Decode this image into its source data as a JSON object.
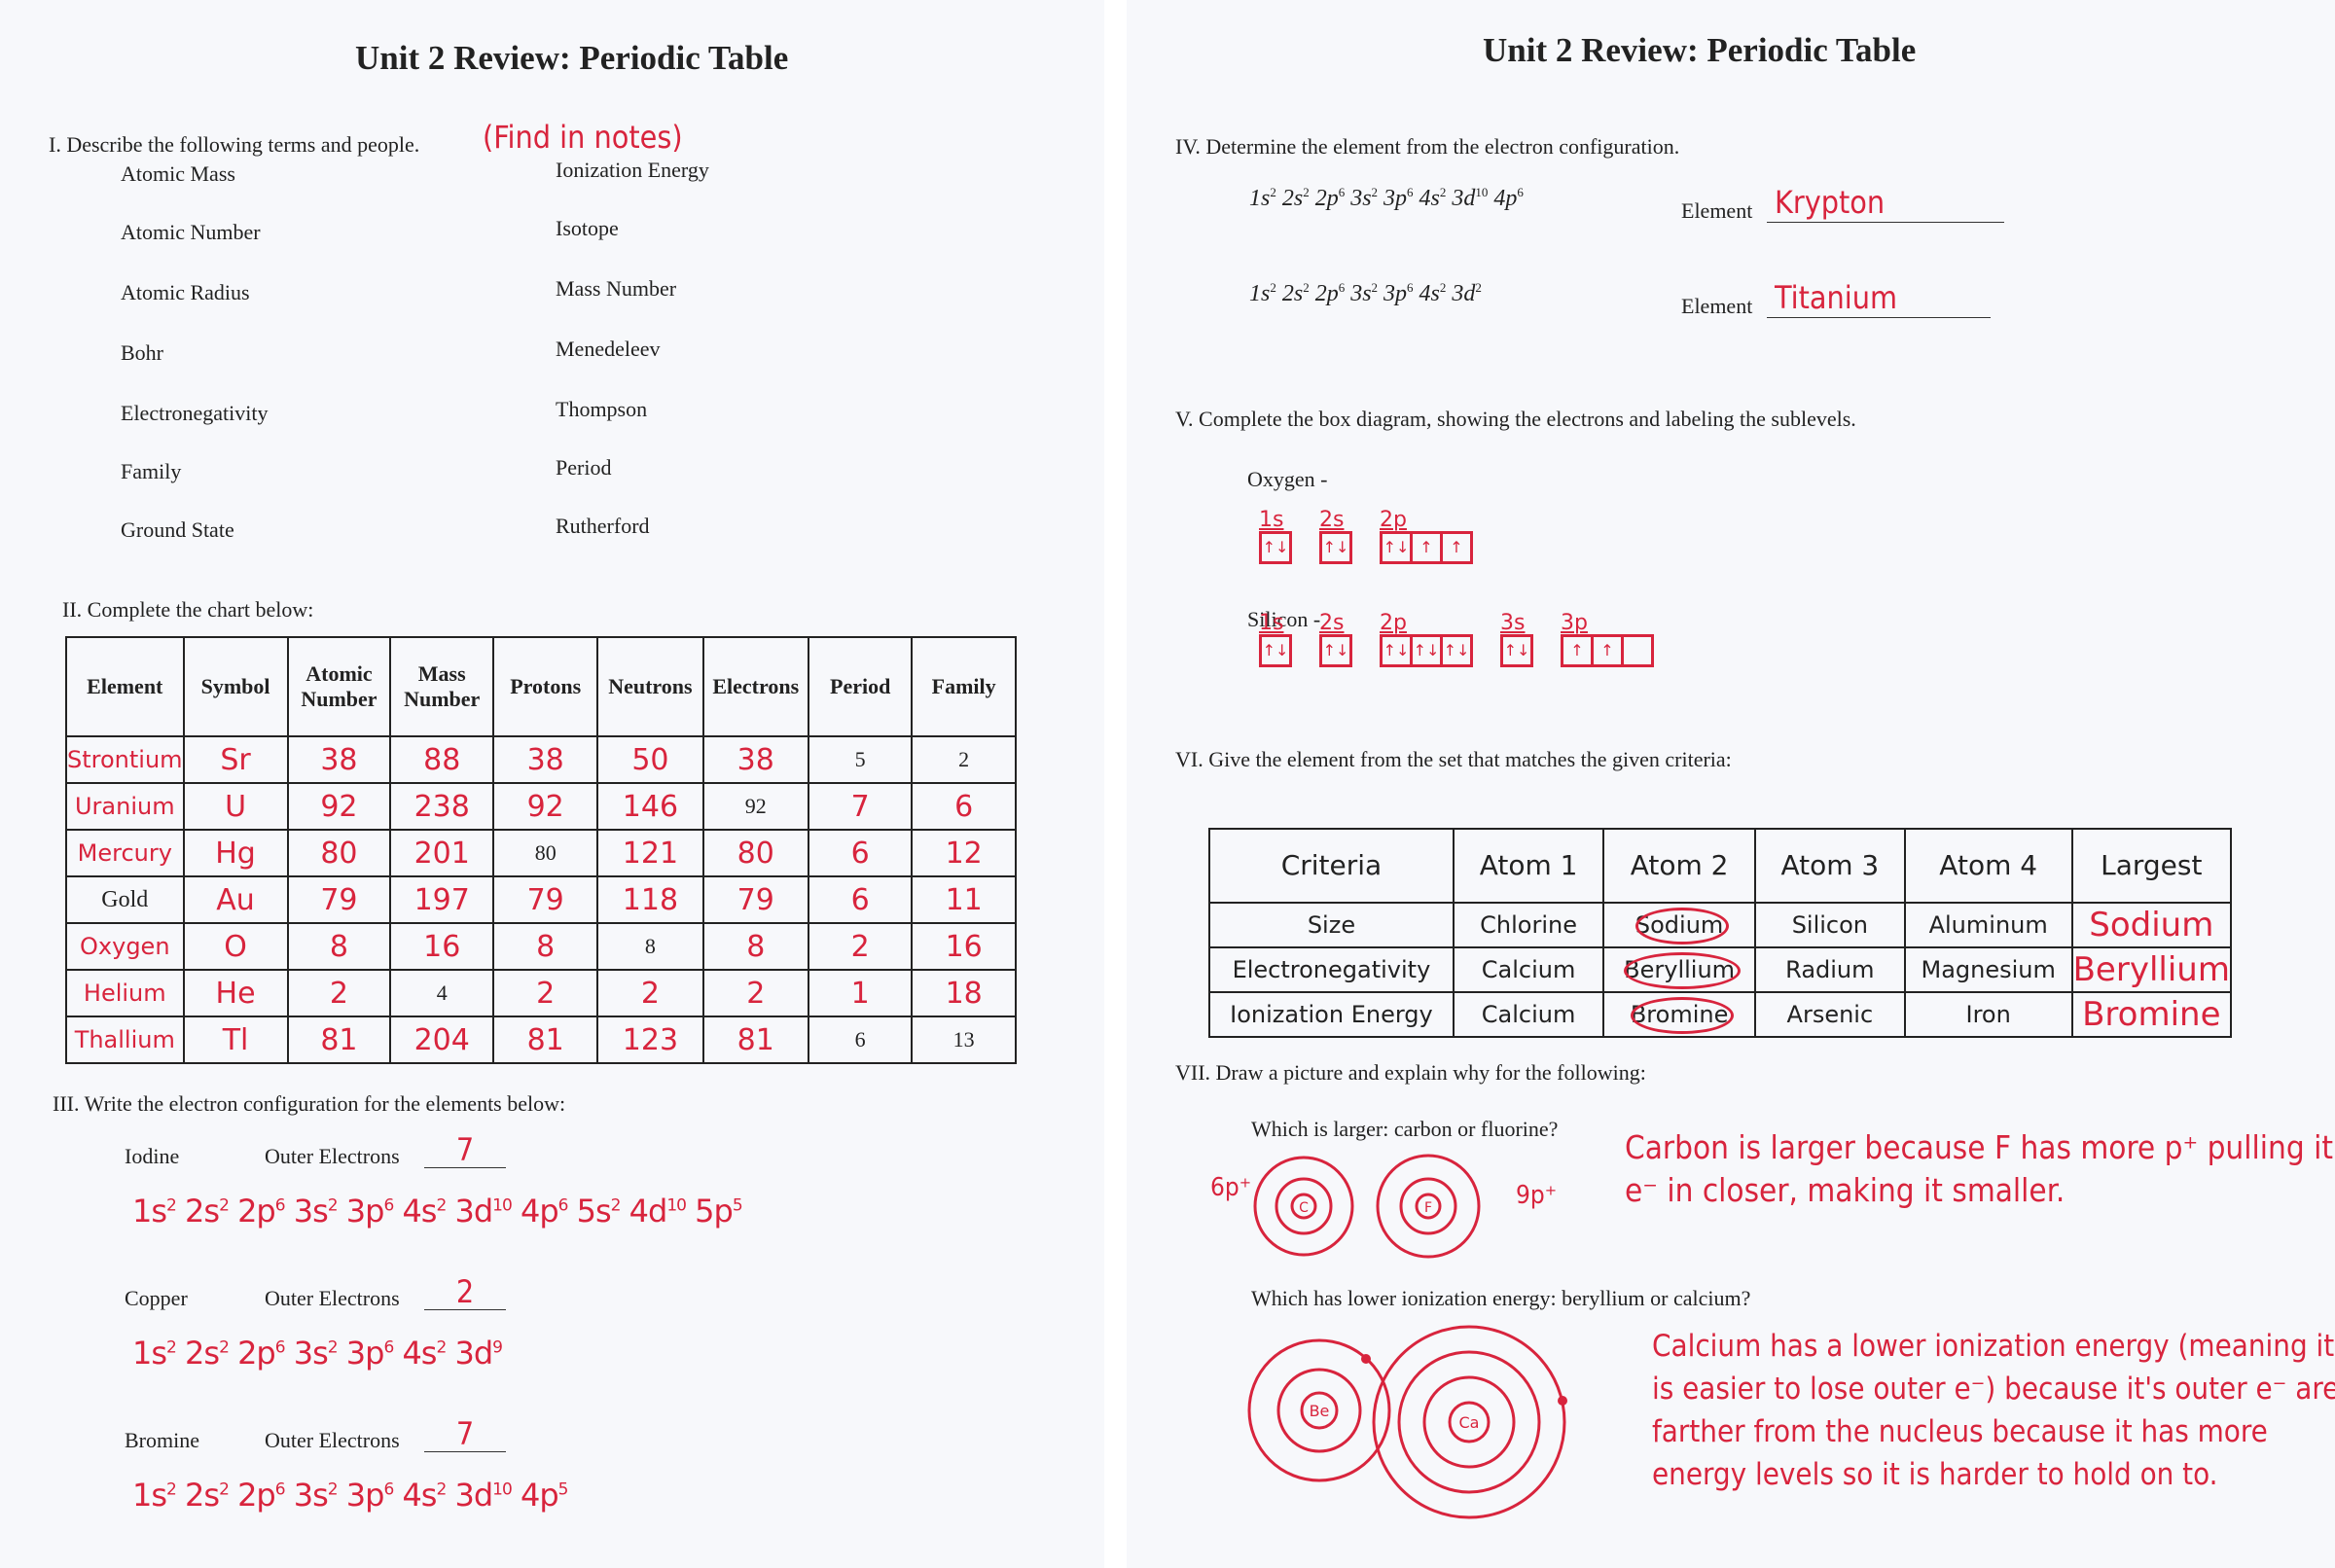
{
  "title": "Unit 2 Review:  Periodic Table",
  "section1": {
    "heading": "I. Describe the following terms and people.",
    "note": "(Find in notes)",
    "left_terms": [
      "Atomic Mass",
      "Atomic Number",
      "Atomic Radius",
      "Bohr",
      "Electronegativity",
      "Family",
      "Ground State"
    ],
    "right_terms": [
      "Ionization Energy",
      "Isotope",
      "Mass Number",
      "Menedeleev",
      "Thompson",
      "Period",
      "Rutherford"
    ]
  },
  "section2": {
    "heading": "II.  Complete the chart below:",
    "headers": [
      "Element",
      "Symbol",
      "Atomic Number",
      "Mass Number",
      "Protons",
      "Neutrons",
      "Electrons",
      "Period",
      "Family"
    ],
    "rows": [
      {
        "cells": [
          "Strontium",
          "Sr",
          "38",
          "88",
          "38",
          "50",
          "38",
          "5",
          "2"
        ],
        "printed": [
          7,
          8
        ]
      },
      {
        "cells": [
          "Uranium",
          "U",
          "92",
          "238",
          "92",
          "146",
          "92",
          "7",
          "6"
        ],
        "printed": [
          6
        ]
      },
      {
        "cells": [
          "Mercury",
          "Hg",
          "80",
          "201",
          "80",
          "121",
          "80",
          "6",
          "12"
        ],
        "printed": [
          4
        ]
      },
      {
        "cells": [
          "Gold",
          "Au",
          "79",
          "197",
          "79",
          "118",
          "79",
          "6",
          "11"
        ],
        "printed": [
          0
        ]
      },
      {
        "cells": [
          "Oxygen",
          "O",
          "8",
          "16",
          "8",
          "8",
          "8",
          "2",
          "16"
        ],
        "printed": [
          5
        ]
      },
      {
        "cells": [
          "Helium",
          "He",
          "2",
          "4",
          "2",
          "2",
          "2",
          "1",
          "18"
        ],
        "printed": [
          3
        ]
      },
      {
        "cells": [
          "Thallium",
          "Tl",
          "81",
          "204",
          "81",
          "123",
          "81",
          "6",
          "13"
        ],
        "printed": [
          7,
          8
        ]
      }
    ]
  },
  "section3": {
    "heading": "III.  Write the electron configuration for the elements below:",
    "outer_label": "Outer Electrons",
    "items": [
      {
        "element": "Iodine",
        "outer": "7",
        "config": [
          [
            "1s",
            "2"
          ],
          [
            "2s",
            "2"
          ],
          [
            "2p",
            "6"
          ],
          [
            "3s",
            "2"
          ],
          [
            "3p",
            "6"
          ],
          [
            "4s",
            "2"
          ],
          [
            "3d",
            "10"
          ],
          [
            "4p",
            "6"
          ],
          [
            "5s",
            "2"
          ],
          [
            "4d",
            "10"
          ],
          [
            "5p",
            "5"
          ]
        ]
      },
      {
        "element": "Copper",
        "outer": "2",
        "config": [
          [
            "1s",
            "2"
          ],
          [
            "2s",
            "2"
          ],
          [
            "2p",
            "6"
          ],
          [
            "3s",
            "2"
          ],
          [
            "3p",
            "6"
          ],
          [
            "4s",
            "2"
          ],
          [
            "3d",
            "9"
          ]
        ]
      },
      {
        "element": "Bromine",
        "outer": "7",
        "config": [
          [
            "1s",
            "2"
          ],
          [
            "2s",
            "2"
          ],
          [
            "2p",
            "6"
          ],
          [
            "3s",
            "2"
          ],
          [
            "3p",
            "6"
          ],
          [
            "4s",
            "2"
          ],
          [
            "3d",
            "10"
          ],
          [
            "4p",
            "5"
          ]
        ]
      }
    ]
  },
  "section4": {
    "heading": "IV.  Determine the element from the electron configuration.",
    "element_label": "Element",
    "items": [
      {
        "config": [
          [
            "1s",
            "2"
          ],
          [
            "2s",
            "2"
          ],
          [
            "2p",
            "6"
          ],
          [
            "3s",
            "2"
          ],
          [
            "3p",
            "6"
          ],
          [
            "4s",
            "2"
          ],
          [
            "3d",
            "10"
          ],
          [
            "4p",
            "6"
          ]
        ],
        "answer": "Krypton"
      },
      {
        "config": [
          [
            "1s",
            "2"
          ],
          [
            "2s",
            "2"
          ],
          [
            "2p",
            "6"
          ],
          [
            "3s",
            "2"
          ],
          [
            "3p",
            "6"
          ],
          [
            "4s",
            "2"
          ],
          [
            "3d",
            "2"
          ]
        ],
        "answer": "Titanium"
      }
    ]
  },
  "section5": {
    "heading": "V.  Complete the box diagram, showing the electrons and labeling the sublevels.",
    "items": [
      {
        "element": "Oxygen -",
        "orbitals": [
          {
            "label": "1s",
            "boxes": [
              "↑↓"
            ]
          },
          {
            "label": "2s",
            "boxes": [
              "↑↓"
            ]
          },
          {
            "label": "2p",
            "boxes": [
              "↑↓",
              "↑",
              "↑"
            ]
          }
        ]
      },
      {
        "element": "Silicon -",
        "orbitals": [
          {
            "label": "1s",
            "boxes": [
              "↑↓"
            ]
          },
          {
            "label": "2s",
            "boxes": [
              "↑↓"
            ]
          },
          {
            "label": "2p",
            "boxes": [
              "↑↓",
              "↑↓",
              "↑↓"
            ]
          },
          {
            "label": "3s",
            "boxes": [
              "↑↓"
            ]
          },
          {
            "label": "3p",
            "boxes": [
              "↑",
              "↑",
              ""
            ]
          }
        ]
      }
    ]
  },
  "section6": {
    "heading": "VI.  Give the element from the set that matches the given criteria:",
    "headers": [
      "Criteria",
      "Atom 1",
      "Atom 2",
      "Atom 3",
      "Atom 4",
      "Largest"
    ],
    "rows": [
      {
        "criteria": "Size",
        "atoms": [
          "Chlorine",
          "Sodium",
          "Silicon",
          "Aluminum"
        ],
        "circled": 1,
        "answer": "Sodium"
      },
      {
        "criteria": "Electronegativity",
        "atoms": [
          "Calcium",
          "Beryllium",
          "Radium",
          "Magnesium"
        ],
        "circled": 1,
        "answer": "Beryllium"
      },
      {
        "criteria": "Ionization Energy",
        "atoms": [
          "Calcium",
          "Bromine",
          "Arsenic",
          "Iron"
        ],
        "circled": 1,
        "answer": "Bromine"
      }
    ]
  },
  "section7": {
    "heading": "VII.  Draw a picture and explain why for the following:",
    "q1": {
      "question": "Which is larger:  carbon or fluorine?",
      "left_label": "6p⁺",
      "right_label": "9p⁺",
      "atom1": "C",
      "atom2": "F",
      "answer": "Carbon is larger because F has more p⁺ pulling it's outer e⁻ in closer, making it smaller."
    },
    "q2": {
      "question": "Which has lower ionization energy:  beryllium or calcium?",
      "atom1": "Be",
      "atom2": "Ca",
      "answer": "Calcium has a lower ionization energy (meaning it is easier to lose outer e⁻) because it's outer e⁻ are farther from the nucleus because it has more energy levels so it is harder to hold on to."
    }
  },
  "colors": {
    "ink": "#d8243d",
    "print": "#222222",
    "paper": "#f7f8fb"
  }
}
